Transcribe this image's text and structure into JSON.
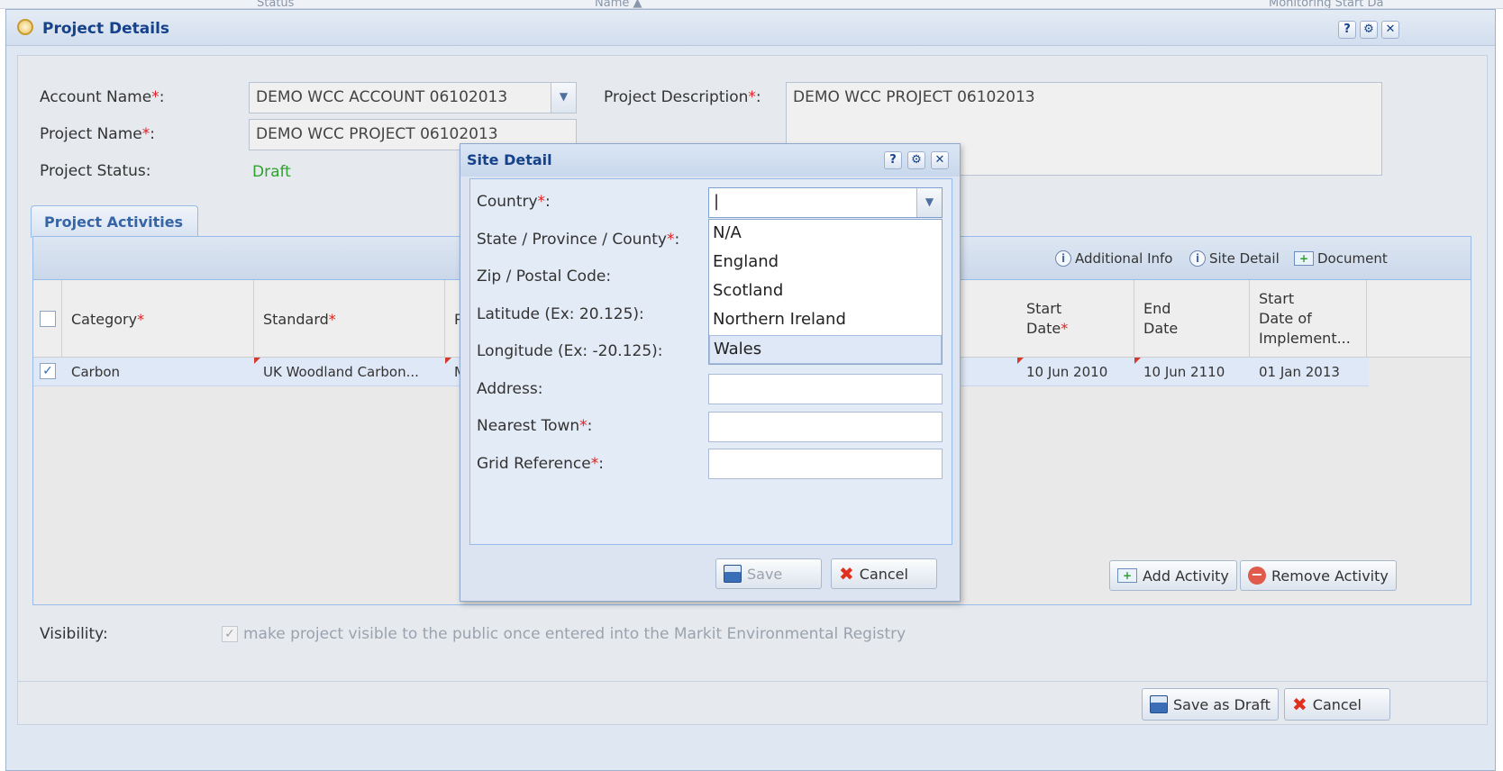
{
  "background_strip": {
    "col1": "Status",
    "col2": "Name ▲",
    "col3": "Monitoring Start Da"
  },
  "window": {
    "title": "Project Details",
    "help_btn": "?",
    "settings_btn": "⚙",
    "close_btn": "✕"
  },
  "form": {
    "account_name_label": "Account Name",
    "account_name_value": "DEMO WCC ACCOUNT 06102013",
    "project_name_label": "Project Name",
    "project_name_value": "DEMO WCC PROJECT 06102013",
    "project_status_label": "Project Status:",
    "project_status_value": "Draft",
    "project_description_label": "Project Description",
    "project_description_value": "DEMO WCC PROJECT 06102013",
    "required_mark": "*",
    "colon": ":"
  },
  "tabs": [
    {
      "label": "Project Activities"
    }
  ],
  "grid": {
    "toolbar": {
      "additional_info": "Additional Info",
      "site_detail": "Site Detail",
      "document": "Document"
    },
    "headers": {
      "category": "Category",
      "standard": "Standard",
      "p": "P",
      "start_date_l1": "Start",
      "start_date_l2": "Date",
      "end_date_l1": "End",
      "end_date_l2": "Date",
      "start_impl_l1": "Start",
      "start_impl_l2": "Date of",
      "start_impl_l3": "Implement..."
    },
    "rows": [
      {
        "checked": "✓",
        "category": "Carbon",
        "standard": "UK Woodland Carbon...",
        "p": "M",
        "start_date": "10 Jun 2010",
        "end_date": "10 Jun 2110",
        "start_impl": "01 Jan 2013"
      }
    ],
    "add_activity": "Add Activity",
    "remove_activity": "Remove Activity"
  },
  "visibility": {
    "label": "Visibility:",
    "checkbox": "✓",
    "text": "make project visible to the public once entered into the Markit Environmental Registry"
  },
  "footer": {
    "save_draft": "Save as Draft",
    "cancel": "Cancel"
  },
  "dialog": {
    "title": "Site Detail",
    "help_btn": "?",
    "settings_btn": "⚙",
    "close_btn": "✕",
    "country_label": "Country",
    "country_value": "|",
    "state_label": "State / Province / County",
    "zip_label": "Zip / Postal Code:",
    "latitude_label": "Latitude (Ex: 20.125):",
    "longitude_label": "Longitude (Ex: -20.125):",
    "address_label": "Address:",
    "nearest_town_label": "Nearest Town",
    "grid_reference_label": "Grid Reference",
    "dropdown_options": [
      "N/A",
      "England",
      "Scotland",
      "Northern Ireland",
      "Wales"
    ],
    "save": "Save",
    "cancel": "Cancel"
  },
  "colors": {
    "accent": "#15428b",
    "required": "#e0201f",
    "status_green": "#2ea32e"
  }
}
